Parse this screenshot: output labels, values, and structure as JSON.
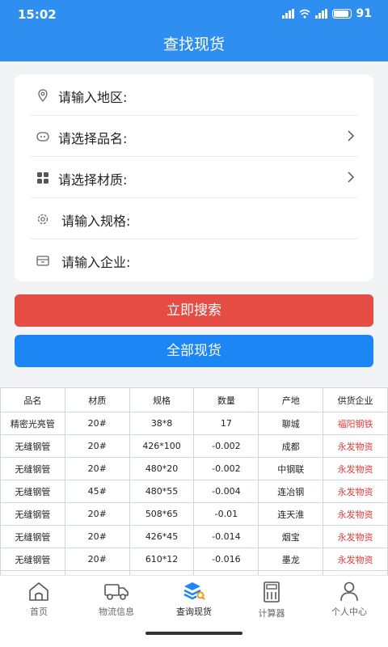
{
  "status_bar": {
    "time": "15:02",
    "battery": "91"
  },
  "header": {
    "title": "查找现货"
  },
  "form": {
    "region_label": "请输入地区:",
    "name_label": "请选择品名:",
    "material_label": "请选择材质:",
    "spec_label": "请输入规格:",
    "company_label": "请输入企业:"
  },
  "actions": {
    "search": "立即搜索",
    "all": "全部现货"
  },
  "table": {
    "headers": [
      "品名",
      "材质",
      "规格",
      "数量",
      "产地",
      "供货企业"
    ],
    "rows": [
      [
        "精密光亮管",
        "20#",
        "38*8",
        "17",
        "聊城",
        "福阳钢铁"
      ],
      [
        "无缝钢管",
        "20#",
        "426*100",
        "-0.002",
        "成都",
        "永发物资"
      ],
      [
        "无缝钢管",
        "20#",
        "480*20",
        "-0.002",
        "中钢联",
        "永发物资"
      ],
      [
        "无缝钢管",
        "45#",
        "480*55",
        "-0.004",
        "连冶钢",
        "永发物资"
      ],
      [
        "无缝钢管",
        "20#",
        "508*65",
        "-0.01",
        "连天淮",
        "永发物资"
      ],
      [
        "无缝钢管",
        "20#",
        "426*45",
        "-0.014",
        "烟宝",
        "永发物资"
      ],
      [
        "无缝钢管",
        "20#",
        "610*12",
        "-0.016",
        "墨龙",
        "永发物资"
      ],
      [
        "",
        "",
        "",
        "",
        "",
        ""
      ]
    ]
  },
  "tabs": [
    {
      "label": "首页",
      "icon": "home-icon"
    },
    {
      "label": "物流信息",
      "icon": "truck-icon"
    },
    {
      "label": "查询现货",
      "icon": "stack-search-icon"
    },
    {
      "label": "计算器",
      "icon": "calculator-icon"
    },
    {
      "label": "个人中心",
      "icon": "user-icon"
    }
  ],
  "colors": {
    "primary": "#2f8ff0",
    "search_button": "#e44c44",
    "all_button": "#1d86f5",
    "supplier_text": "#e53935"
  }
}
